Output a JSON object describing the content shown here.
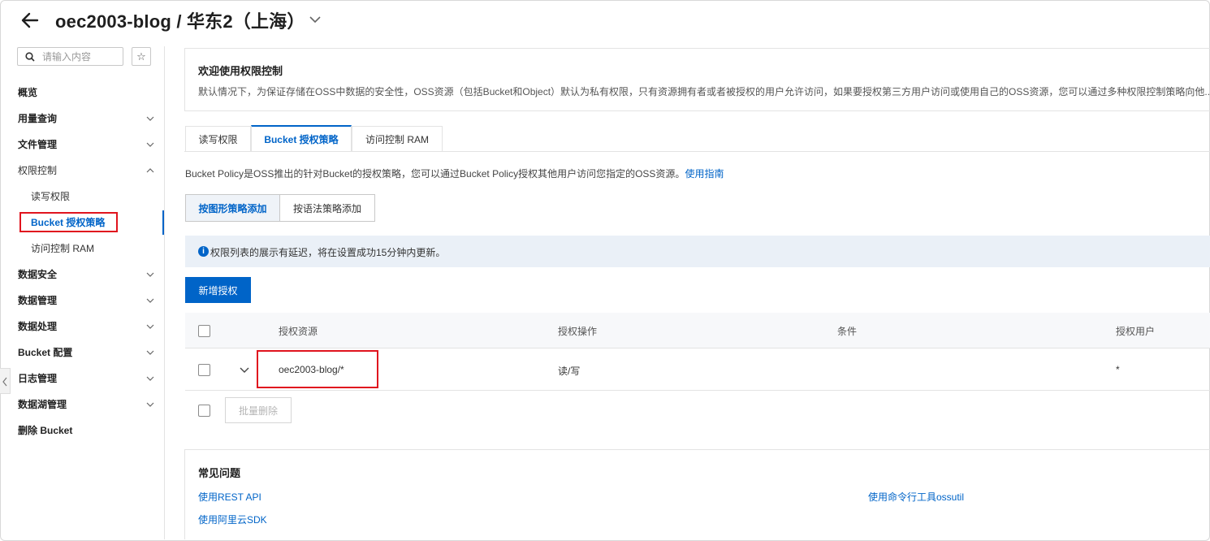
{
  "header": {
    "title": "oec2003-blog / 华东2（上海）"
  },
  "sidebar": {
    "search_placeholder": "请输入内容",
    "star": "☆",
    "items": [
      {
        "label": "概览"
      },
      {
        "label": "用量查询"
      },
      {
        "label": "文件管理"
      },
      {
        "label": "权限控制"
      },
      {
        "label": "数据安全"
      },
      {
        "label": "数据管理"
      },
      {
        "label": "数据处理"
      },
      {
        "label": "Bucket 配置"
      },
      {
        "label": "日志管理"
      },
      {
        "label": "数据湖管理"
      },
      {
        "label": "删除 Bucket"
      }
    ],
    "sub_items": [
      {
        "label": "读写权限"
      },
      {
        "label": "Bucket 授权策略"
      },
      {
        "label": "访问控制 RAM"
      }
    ]
  },
  "welcome": {
    "title": "欢迎使用权限控制",
    "desc": "默认情况下，为保证存储在OSS中数据的安全性，OSS资源（包括Bucket和Object）默认为私有权限，只有资源拥有者或者被授权的用户允许访问，如果要授权第三方用户访问或使用自己的OSS资源，您可以通过多种权限控制策略向他..."
  },
  "tabs": [
    {
      "label": "读写权限"
    },
    {
      "label": "Bucket 授权策略"
    },
    {
      "label": "访问控制 RAM"
    }
  ],
  "policy": {
    "desc": "Bucket Policy是OSS推出的针对Bucket的授权策略，您可以通过Bucket Policy授权其他用户访问您指定的OSS资源。",
    "guide_link": "使用指南"
  },
  "mode_buttons": {
    "graphic": "按图形策略添加",
    "syntax": "按语法策略添加"
  },
  "notice": {
    "icon": "i",
    "text": "权限列表的展示有延迟，将在设置成功15分钟内更新。"
  },
  "add_button": "新增授权",
  "table": {
    "headers": [
      "授权资源",
      "授权操作",
      "条件",
      "授权用户"
    ],
    "rows": [
      {
        "resource": "oec2003-blog/*",
        "action": "读/写",
        "condition": "",
        "user": "*"
      }
    ],
    "batch_delete": "批量删除"
  },
  "faq": {
    "title": "常见问题",
    "links": [
      "使用REST API",
      "使用命令行工具ossutil",
      "使用阿里云SDK"
    ]
  },
  "colors": {
    "accent": "#0064c8",
    "highlight": "#e0141e"
  }
}
